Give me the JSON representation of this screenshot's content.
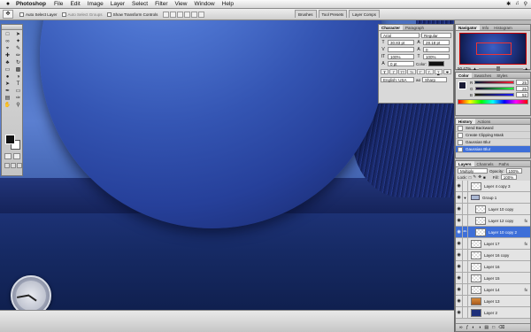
{
  "menubar": {
    "apple": "",
    "app_name": "Photoshop",
    "items": [
      "File",
      "Edit",
      "Image",
      "Layer",
      "Select",
      "Filter",
      "View",
      "Window",
      "Help"
    ]
  },
  "options": {
    "auto_select_layer": "Auto Select Layer",
    "auto_select_groups": "Auto Select Groups",
    "show_transform": "Show Transform Controls",
    "well_tabs": [
      "Brushes",
      "Tool Presets",
      "Layer Comps"
    ]
  },
  "character_panel": {
    "tabs": [
      "Character",
      "Paragraph"
    ],
    "font_family": "Arial",
    "font_style": "Regular",
    "font_size": "30.83 pt",
    "leading": "28.18 pt",
    "tracking": "0",
    "vertical_scale": "100%",
    "horizontal_scale": "100%",
    "baseline": "0 pt",
    "color_label": "Color:",
    "language": "English: USA",
    "aa_label": "aɑ",
    "aa_mode": "Sharp",
    "style_buttons": [
      "T",
      "T",
      "TT",
      "Tt",
      "T'",
      "T,",
      "T",
      "T"
    ]
  },
  "navigator": {
    "tabs": [
      "Navigator",
      "Info",
      "Histogram"
    ],
    "zoom": "50.47%"
  },
  "color": {
    "tabs": [
      "Color",
      "Swatches",
      "Styles"
    ],
    "channels": [
      {
        "label": "R",
        "value": "25"
      },
      {
        "label": "G",
        "value": "26"
      },
      {
        "label": "B",
        "value": "52"
      }
    ]
  },
  "history": {
    "tabs": [
      "History",
      "Actions"
    ],
    "items": [
      "Send Backward",
      "Create Clipping Mask",
      "Gaussian Blur",
      "Gaussian Blur"
    ],
    "selected_index": 3
  },
  "layers": {
    "tabs": [
      "Layers",
      "Channels",
      "Paths"
    ],
    "blend_mode": "Multiply",
    "opacity_label": "Opacity:",
    "opacity": "100%",
    "lock_label": "Lock:",
    "fill_label": "Fill:",
    "fill": "100%",
    "items": [
      {
        "name": "Layer 4 copy 3",
        "type": "layer",
        "fx": ""
      },
      {
        "name": "Group 1",
        "type": "group",
        "fx": ""
      },
      {
        "name": "Layer 10 copy",
        "type": "layer",
        "fx": ""
      },
      {
        "name": "Layer 12 copy",
        "type": "layer",
        "fx": "fx"
      },
      {
        "name": "Layer 10 copy 2",
        "type": "layer",
        "fx": ""
      },
      {
        "name": "Layer 17",
        "type": "layer",
        "fx": "fx"
      },
      {
        "name": "Layer 16 copy",
        "type": "layer",
        "fx": ""
      },
      {
        "name": "Layer 16",
        "type": "layer",
        "fx": ""
      },
      {
        "name": "Layer 15",
        "type": "layer",
        "fx": ""
      },
      {
        "name": "Layer 14",
        "type": "layer",
        "fx": "fx"
      },
      {
        "name": "Layer 13",
        "type": "layer",
        "fx": ""
      },
      {
        "name": "Layer 2",
        "type": "layer",
        "fx": ""
      }
    ],
    "selected_index": 4
  },
  "icons": {
    "move_tool": "move-tool-icon",
    "eye": "eye-icon",
    "clock": "clock-widget"
  },
  "colors": {
    "accent": "#3e6fd8",
    "ball": "#3455b3",
    "canvas_dark": "#10204f"
  }
}
